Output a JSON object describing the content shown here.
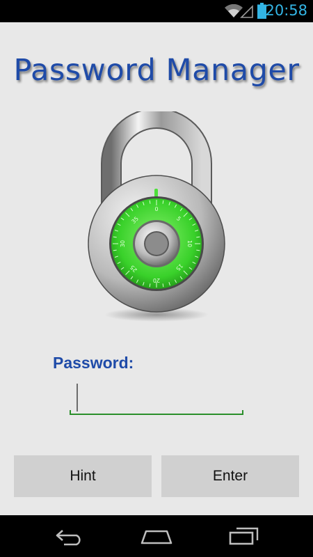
{
  "status_bar": {
    "time": "20:58",
    "icons": [
      "wifi-icon",
      "signal-icon",
      "battery-icon"
    ],
    "accent_color": "#33b5e5"
  },
  "app": {
    "title": "Password Manager",
    "title_color": "#1f4ba8"
  },
  "lock": {
    "icon": "padlock-icon",
    "dial_numbers": [
      "0",
      "5",
      "10",
      "15",
      "20",
      "25",
      "30",
      "35"
    ],
    "dial_color": "#39d12a"
  },
  "form": {
    "password_label": "Password:",
    "password_value": "",
    "underline_color": "#2a8f2a"
  },
  "buttons": {
    "hint_label": "Hint",
    "enter_label": "Enter"
  },
  "nav_bar": {
    "icons": [
      "back-icon",
      "home-icon",
      "recents-icon"
    ]
  }
}
